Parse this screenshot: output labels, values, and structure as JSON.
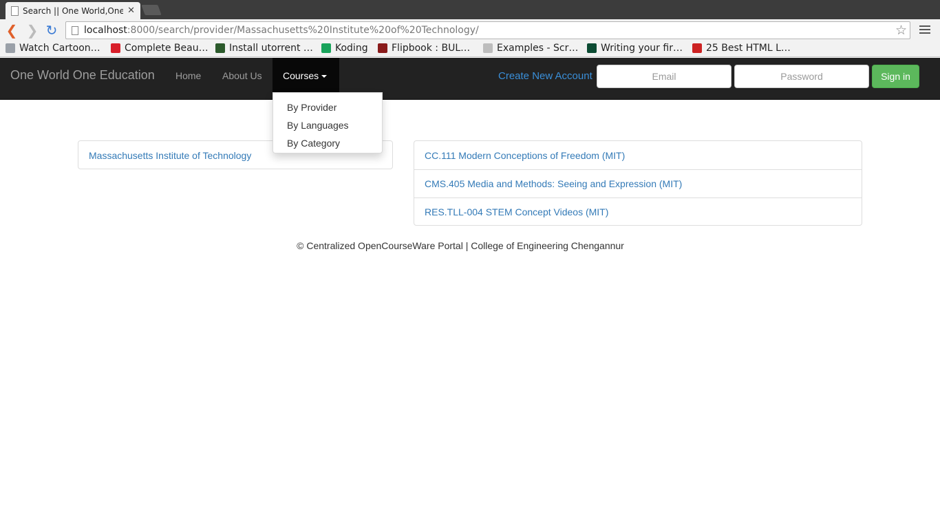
{
  "browser": {
    "tab_title": "Search || One World,One E",
    "url_host": "localhost",
    "url_path": ":8000/search/provider/Massachusetts%20Institute%20of%20Technology/",
    "bookmarks": [
      {
        "label": "Watch Cartoon…",
        "icon_color": "#9aa0a8"
      },
      {
        "label": "Complete Beau…",
        "icon_color": "#d81f2a"
      },
      {
        "label": "Install utorrent …",
        "icon_color": "#2c5a2c"
      },
      {
        "label": "Koding",
        "icon_color": "#19a35b"
      },
      {
        "label": "Flipbook : BUL…",
        "icon_color": "#8a1b1b"
      },
      {
        "label": "Examples - Scr…",
        "icon_color": "#bdbdbd"
      },
      {
        "label": "Writing your fir…",
        "icon_color": "#0c4b33"
      },
      {
        "label": "25 Best HTML L…",
        "icon_color": "#cc2222"
      }
    ]
  },
  "navbar": {
    "brand": "One World One Education",
    "home": "Home",
    "about": "About Us",
    "courses": "Courses",
    "create_account": "Create New Account",
    "email_placeholder": "Email",
    "password_placeholder": "Password",
    "signin": "Sign in"
  },
  "dropdown": {
    "items": [
      "By Provider",
      "By Languages",
      "By Category"
    ]
  },
  "provider": {
    "name": "Massachusetts Institute of Technology"
  },
  "courses": [
    "CC.111 Modern Conceptions of Freedom (MIT)",
    "CMS.405 Media and Methods: Seeing and Expression (MIT)",
    "RES.TLL-004 STEM Concept Videos (MIT)"
  ],
  "footer": "© Centralized OpenCourseWare Portal | College of Engineering Chengannur",
  "colors": {
    "navbar_bg": "#222222",
    "link": "#337ab7",
    "signin_bg": "#5cb85c"
  }
}
